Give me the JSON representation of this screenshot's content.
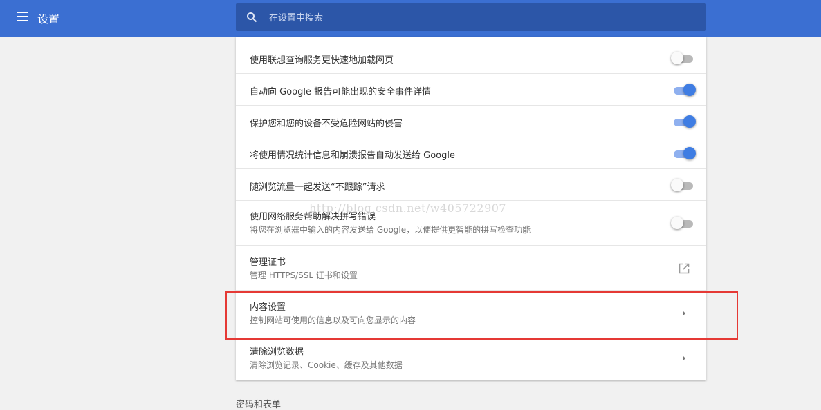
{
  "header": {
    "title": "设置",
    "search_placeholder": "在设置中搜索"
  },
  "rows": [
    {
      "label": "使用联想查询服务更快速地加载网页",
      "control": "toggle",
      "value": false
    },
    {
      "label": "自动向 Google 报告可能出现的安全事件详情",
      "control": "toggle",
      "value": true
    },
    {
      "label": "保护您和您的设备不受危险网站的侵害",
      "control": "toggle",
      "value": true
    },
    {
      "label": "将使用情况统计信息和崩溃报告自动发送给 Google",
      "control": "toggle",
      "value": true
    },
    {
      "label": "随浏览流量一起发送“不跟踪”请求",
      "control": "toggle",
      "value": false
    },
    {
      "label": "使用网络服务帮助解决拼写错误",
      "sublabel": "将您在浏览器中输入的内容发送给 Google，以便提供更智能的拼写检查功能",
      "control": "toggle",
      "value": false
    },
    {
      "label": "管理证书",
      "sublabel": "管理 HTTPS/SSL 证书和设置",
      "control": "external-link-icon"
    },
    {
      "label": "内容设置",
      "sublabel": "控制网站可使用的信息以及可向您显示的内容",
      "control": "arrow-right-icon"
    },
    {
      "label": "清除浏览数据",
      "sublabel": "清除浏览记录、Cookie、缓存及其他数据",
      "control": "arrow-right-icon"
    }
  ],
  "section_heading_partial": "密码和表单",
  "watermark": "http://blog.csdn.net/w405722907",
  "colors": {
    "header": "#3b6fd2",
    "search_bg": "#2c56a8",
    "toggle_on": "#3f7de3",
    "highlight": "#e53935"
  }
}
